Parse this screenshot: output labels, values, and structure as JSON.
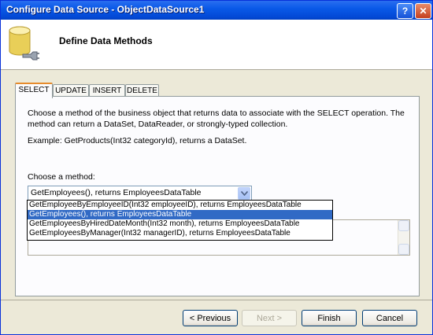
{
  "window": {
    "title": "Configure Data Source - ObjectDataSource1",
    "help": "?",
    "close": "✕"
  },
  "header": {
    "heading": "Define Data Methods",
    "icon": "database-icon"
  },
  "tabs": [
    {
      "label": "SELECT",
      "active": true
    },
    {
      "label": "UPDATE",
      "active": false
    },
    {
      "label": "INSERT",
      "active": false
    },
    {
      "label": "DELETE",
      "active": false
    }
  ],
  "panel": {
    "description": "Choose a method of the business object that returns data to associate with the SELECT operation. The method can return a DataSet, DataReader, or strongly-typed collection.",
    "example": "Example: GetProducts(Int32 categoryId), returns a DataSet.",
    "choose_label": "Choose a method:",
    "selected_method": "GetEmployees(), returns EmployeesDataTable",
    "options": [
      "GetEmployeeByEmployeeID(Int32 employeeID), returns EmployeesDataTable",
      "GetEmployees(), returns EmployeesDataTable",
      "GetEmployeesByHiredDateMonth(Int32 month), returns EmployeesDataTable",
      "GetEmployeesByManager(Int32 managerID), returns EmployeesDataTable"
    ],
    "selected_index": 1
  },
  "buttons": {
    "previous": "< Previous",
    "next": "Next >",
    "finish": "Finish",
    "cancel": "Cancel"
  },
  "colors": {
    "titlebar": "#0a5ae8",
    "selection": "#316ac5",
    "active_tab_accent": "#e68b2c"
  }
}
